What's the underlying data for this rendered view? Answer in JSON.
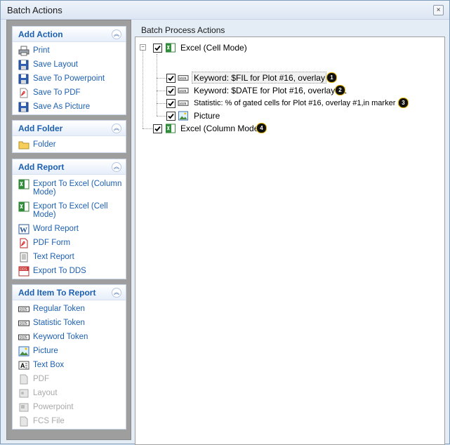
{
  "window": {
    "title": "Batch Actions",
    "close_glyph": "×"
  },
  "sidebar": {
    "groups": [
      {
        "title": "Add Action",
        "items": [
          {
            "label": "Print",
            "icon": "printer-icon",
            "enabled": true
          },
          {
            "label": "Save Layout",
            "icon": "floppy-icon",
            "enabled": true
          },
          {
            "label": "Save To Powerpoint",
            "icon": "floppy-icon",
            "enabled": true
          },
          {
            "label": "Save To PDF",
            "icon": "pdf-icon",
            "enabled": true
          },
          {
            "label": "Save As Picture",
            "icon": "floppy-icon",
            "enabled": true
          }
        ]
      },
      {
        "title": "Add Folder",
        "items": [
          {
            "label": "Folder",
            "icon": "folder-icon",
            "enabled": true
          }
        ]
      },
      {
        "title": "Add Report",
        "items": [
          {
            "label": "Export To Excel (Column Mode)",
            "icon": "excel-icon",
            "enabled": true
          },
          {
            "label": "Export To Excel (Cell Mode)",
            "icon": "excel-icon",
            "enabled": true
          },
          {
            "label": "Word Report",
            "icon": "word-icon",
            "enabled": true
          },
          {
            "label": "PDF Form",
            "icon": "pdf-form-icon",
            "enabled": true
          },
          {
            "label": "Text Report",
            "icon": "text-report-icon",
            "enabled": true
          },
          {
            "label": "Export To DDS",
            "icon": "dds-icon",
            "enabled": true
          }
        ]
      },
      {
        "title": "Add Item To Report",
        "items": [
          {
            "label": "Regular Token",
            "icon": "token-icon",
            "enabled": true
          },
          {
            "label": "Statistic Token",
            "icon": "token-icon",
            "enabled": true
          },
          {
            "label": "Keyword Token",
            "icon": "token-icon",
            "enabled": true
          },
          {
            "label": "Picture",
            "icon": "picture-icon",
            "enabled": true
          },
          {
            "label": "Text Box",
            "icon": "textbox-icon",
            "enabled": true
          },
          {
            "label": "PDF",
            "icon": "pdf-grey-icon",
            "enabled": false
          },
          {
            "label": "Layout",
            "icon": "layout-grey-icon",
            "enabled": false
          },
          {
            "label": "Powerpoint",
            "icon": "powerpoint-grey-icon",
            "enabled": false
          },
          {
            "label": "FCS File",
            "icon": "fcs-grey-icon",
            "enabled": false
          }
        ]
      }
    ]
  },
  "main": {
    "title": "Batch Process Actions",
    "tree": {
      "root1": {
        "label": "Excel (Cell Mode)",
        "checked": true,
        "expander": "−"
      },
      "children": [
        {
          "label": "Keyword: $FIL for Plot #16, overlay #1",
          "checked": true,
          "badge": "1"
        },
        {
          "label": "Keyword: $DATE for Plot #16, overlay #1",
          "checked": true,
          "badge": "2"
        },
        {
          "label": "Statistic: % of gated cells for Plot #16, overlay #1,in marker 1",
          "checked": true,
          "badge": "3"
        },
        {
          "label": "Picture",
          "checked": true,
          "badge": ""
        }
      ],
      "root2": {
        "label": "Excel (Column Mode)",
        "checked": true,
        "badge": "4"
      }
    }
  }
}
